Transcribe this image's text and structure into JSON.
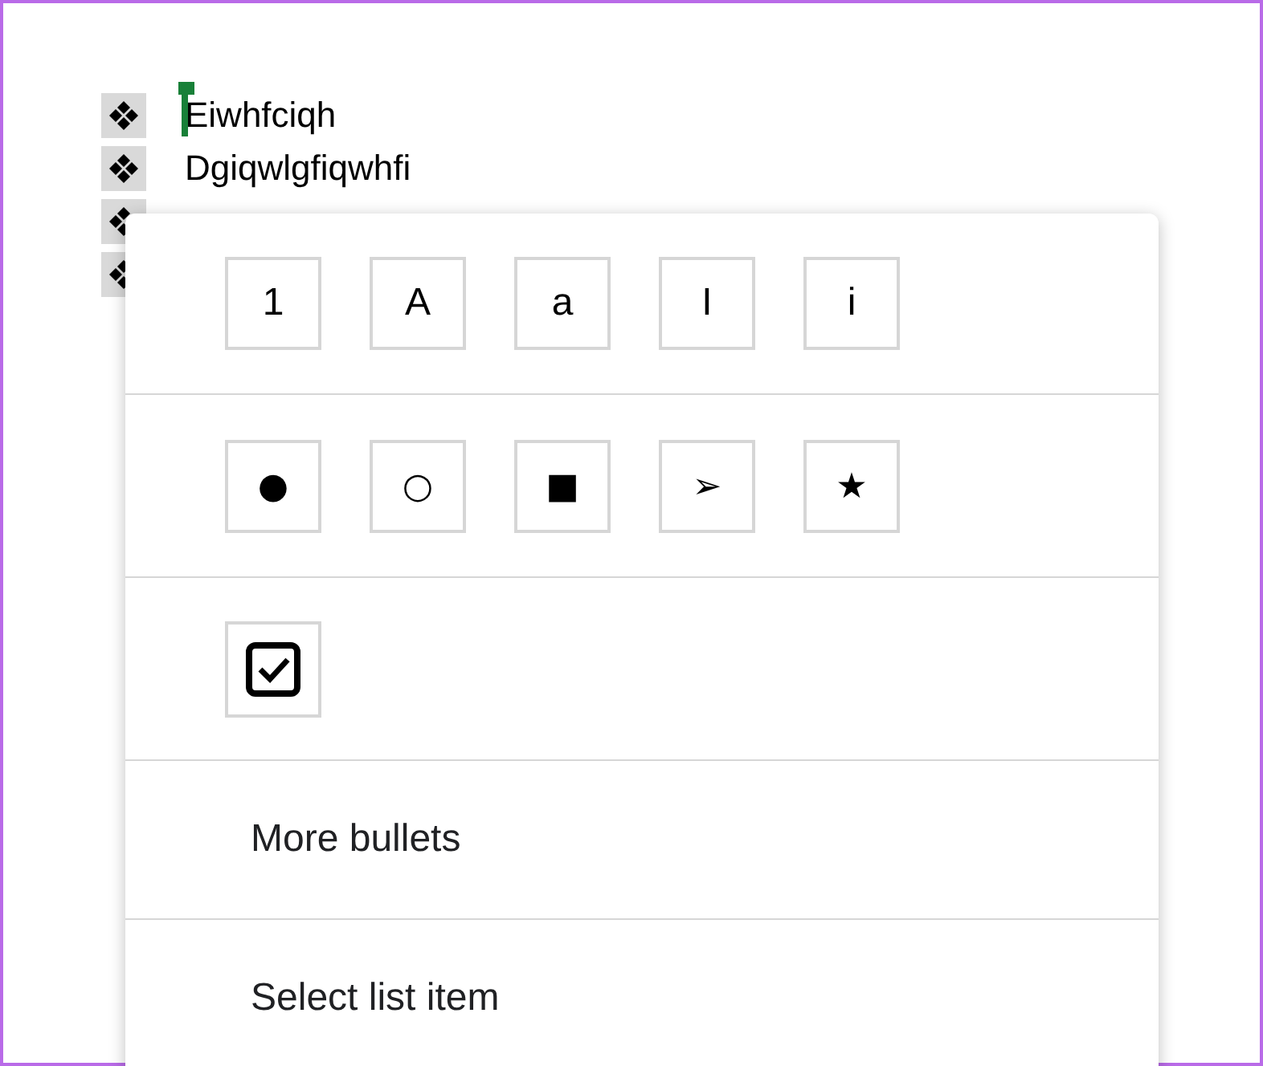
{
  "document": {
    "items": [
      {
        "kind": "text",
        "text": "Eiwhfciqh",
        "cursor": true
      },
      {
        "kind": "text",
        "text": "Dgiqwlgfiqwhfi",
        "cursor": false
      },
      {
        "kind": "bullet_only"
      },
      {
        "kind": "bullet_only"
      }
    ]
  },
  "menu": {
    "numbered_styles": [
      "1",
      "A",
      "a",
      "I",
      "i"
    ],
    "bullet_styles": [
      "●",
      "○",
      "■",
      "➢",
      "★"
    ],
    "actions": [
      "More bullets",
      "Select list item"
    ]
  }
}
